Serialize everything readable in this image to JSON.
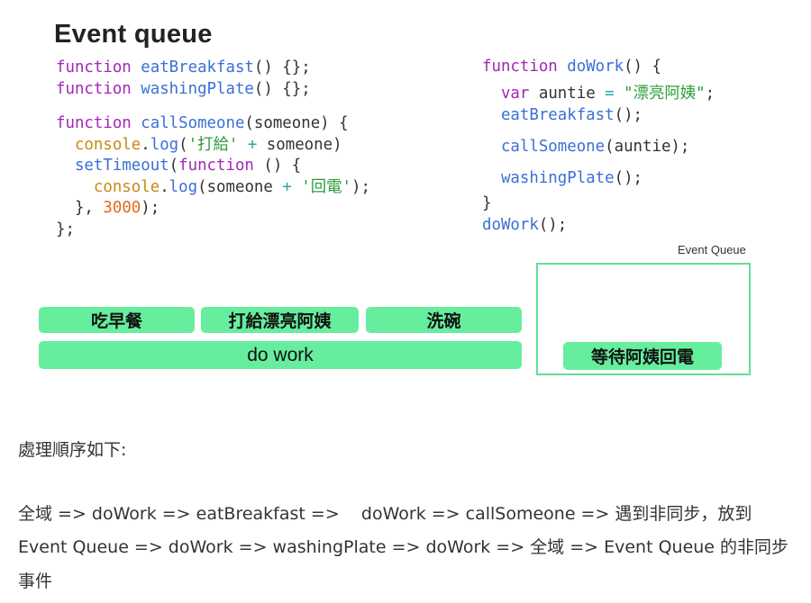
{
  "title": "Event queue",
  "code_left": {
    "l1_kw": "function",
    "l1_fn": "eatBreakfast",
    "l1_rest": "() {};",
    "l2_kw": "function",
    "l2_fn": "washingPlate",
    "l2_rest": "() {};",
    "l3_kw": "function",
    "l3_fn": "callSomeone",
    "l3_rest": "(someone) {",
    "l4_obj": "console",
    "l4_dot": ".",
    "l4_fn": "log",
    "l4_open": "(",
    "l4_str": "'打給'",
    "l4_plus": " + ",
    "l4_rest": "someone)",
    "l5_fn": "setTimeout",
    "l5_open": "(",
    "l5_kw": "function",
    "l5_rest": " () {",
    "l6_obj": "console",
    "l6_dot": ".",
    "l6_fn": "log",
    "l6_open": "(someone ",
    "l6_plus": "+",
    "l6_str": " '回電'",
    "l6_rest": ");",
    "l7_open": "}, ",
    "l7_num": "3000",
    "l7_rest": ");",
    "l8": "};"
  },
  "code_right": {
    "l1_kw": "function",
    "l1_fn": "doWork",
    "l1_rest": "() {",
    "l2_kw": "var",
    "l2_var": "auntie",
    "l2_eq": " = ",
    "l2_str": "\"漂亮阿姨\"",
    "l2_end": ";",
    "l3_fn": "eatBreakfast",
    "l3_rest": "();",
    "l4_fn": "callSomeone",
    "l4_rest": "(auntie);",
    "l5_fn": "washingPlate",
    "l5_rest": "();",
    "l6": "}",
    "l7_fn": "doWork",
    "l7_rest": "();"
  },
  "event_queue_label": "Event Queue",
  "blocks": {
    "breakfast": "吃早餐",
    "call": "打給漂亮阿姨",
    "wash": "洗碗",
    "dowork": "do work",
    "waiting": "等待阿姨回電"
  },
  "note": {
    "heading": "處理順序如下:",
    "line1": "全域 => doWork => eatBreakfast =>    doWork => callSomeone => 遇到非同步，放到",
    "line2": "Event Queue => doWork => washingPlate => doWork => 全域 => Event Queue 的非同步",
    "line3": "事件"
  }
}
